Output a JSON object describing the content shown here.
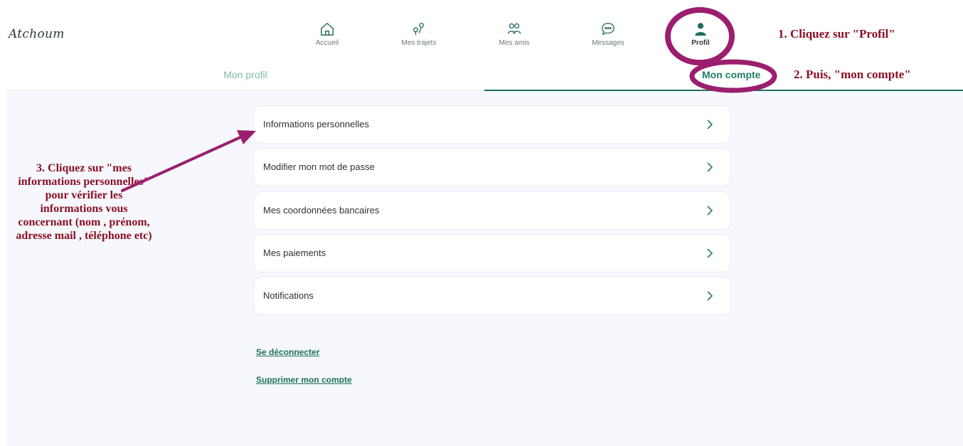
{
  "brand": {
    "logo": "Atchoum"
  },
  "nav": {
    "items": [
      {
        "label": "Accueil",
        "icon": "home-icon"
      },
      {
        "label": "Mes trajets",
        "icon": "route-pin-icon"
      },
      {
        "label": "Mes amis",
        "icon": "friends-icon"
      },
      {
        "label": "Messages",
        "icon": "chat-bubble-icon"
      },
      {
        "label": "Profil",
        "icon": "user-icon",
        "active": true
      }
    ]
  },
  "tabs": [
    {
      "label": "Mon profil",
      "active": false
    },
    {
      "label": "Mon compte",
      "active": true
    }
  ],
  "menu": {
    "items": [
      {
        "label": "Informations personnelles"
      },
      {
        "label": "Modifier mon mot de passe"
      },
      {
        "label": "Mes coordonnées bancaires"
      },
      {
        "label": "Mes paiements"
      },
      {
        "label": "Notifications"
      }
    ]
  },
  "links": {
    "logout": "Se déconnecter",
    "delete": "Supprimer mon compte"
  },
  "annotations": {
    "step1": "1. Cliquez sur \"Profil\"",
    "step2": "2. Puis, \"mon compte\"",
    "step3": "3. Cliquez sur \"mes informations personnelles\" pour vérifier les informations vous concernant (nom , prénom, adresse mail , téléphone etc)"
  },
  "colors": {
    "accent": "#1e6f5d",
    "tab_inactive": "#7fb9ad",
    "annotation": "#8b1024",
    "annotation_ring": "#9b1f6e",
    "background": "#f6f8fd"
  }
}
